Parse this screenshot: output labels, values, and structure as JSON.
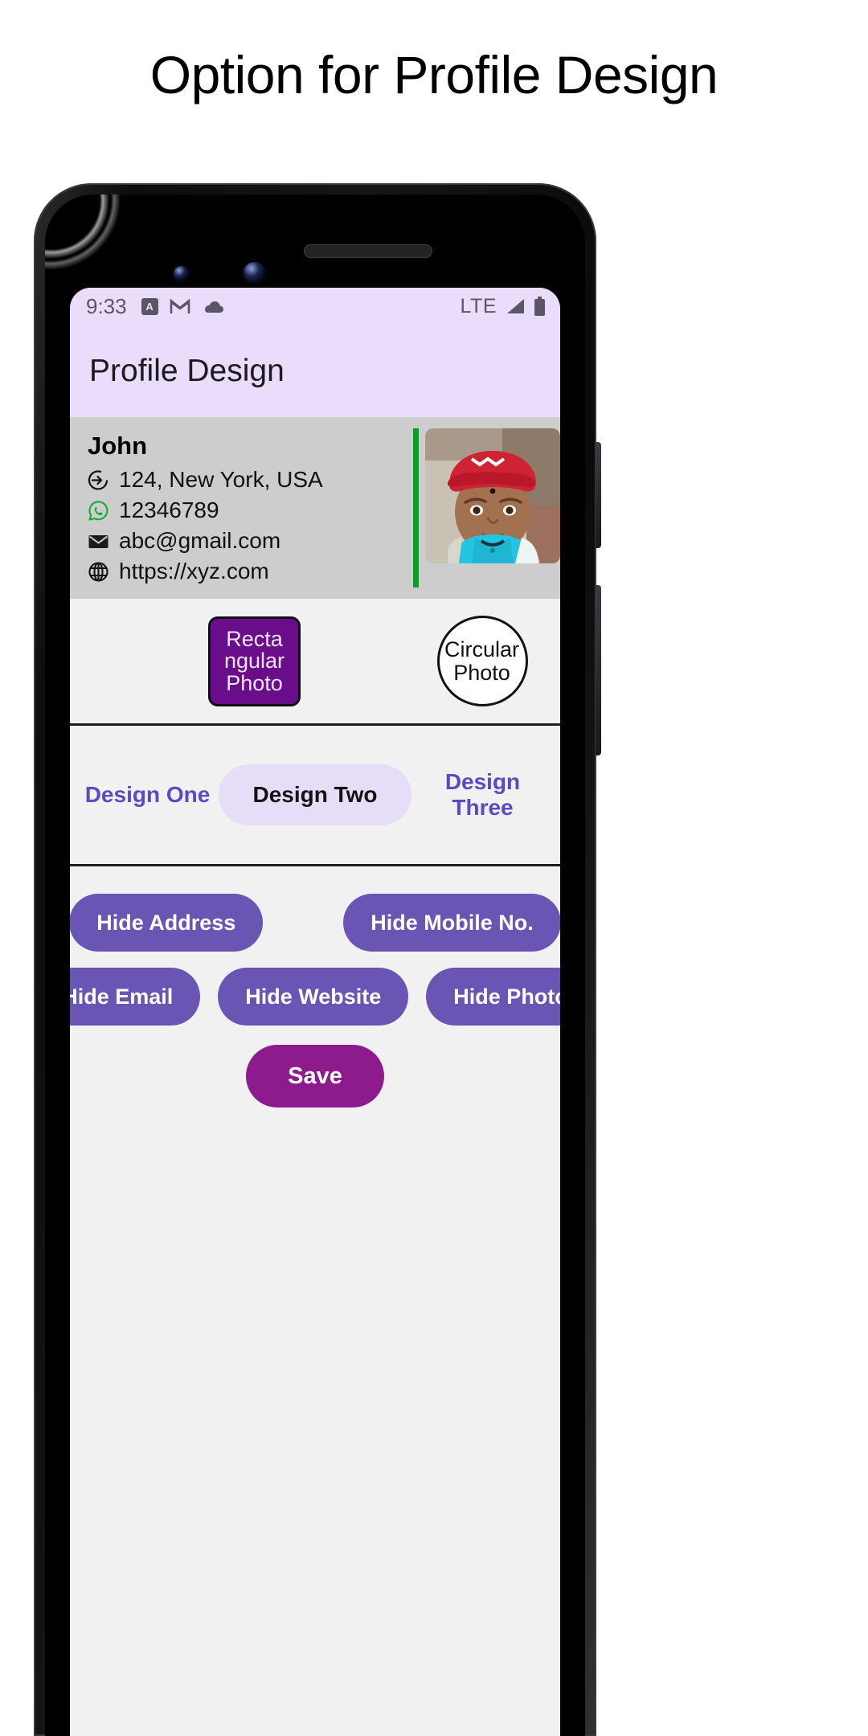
{
  "page": {
    "heading": "Option for Profile Design"
  },
  "statusbar": {
    "time": "9:33",
    "network": "LTE",
    "icons": [
      "app-badge-icon",
      "gmail-icon",
      "cloud-icon",
      "signal-icon",
      "battery-icon"
    ]
  },
  "appbar": {
    "title": "Profile Design"
  },
  "profile": {
    "name": "John",
    "rows": [
      {
        "icon": "address-arrow-icon",
        "text": "124, New York, USA"
      },
      {
        "icon": "whatsapp-icon",
        "text": "12346789"
      },
      {
        "icon": "email-icon",
        "text": "abc@gmail.com"
      },
      {
        "icon": "website-globe-icon",
        "text": "https://xyz.com"
      }
    ],
    "photo_alt": "profile-photo"
  },
  "shape_options": {
    "rectangular": "Recta ngular Photo",
    "circular": "Circular Photo"
  },
  "tabs": [
    {
      "label": "Design One",
      "selected": false
    },
    {
      "label": "Design Two",
      "selected": true
    },
    {
      "label": "Design Three",
      "selected": false
    }
  ],
  "actions": {
    "row1": [
      "Hide Address",
      "Hide Mobile No."
    ],
    "row2": [
      "Hide Email",
      "Hide Website",
      "Hide Photo"
    ],
    "save": "Save"
  },
  "colors": {
    "appbar_bg": "#e9ddfb",
    "card_bg": "#cdcdcd",
    "accent_purple": "#6a55b5",
    "selected_purple": "#6a0d8a",
    "save_magenta": "#8e1b8e",
    "tab_text": "#5b4ac4",
    "green_bar": "#00a321"
  }
}
